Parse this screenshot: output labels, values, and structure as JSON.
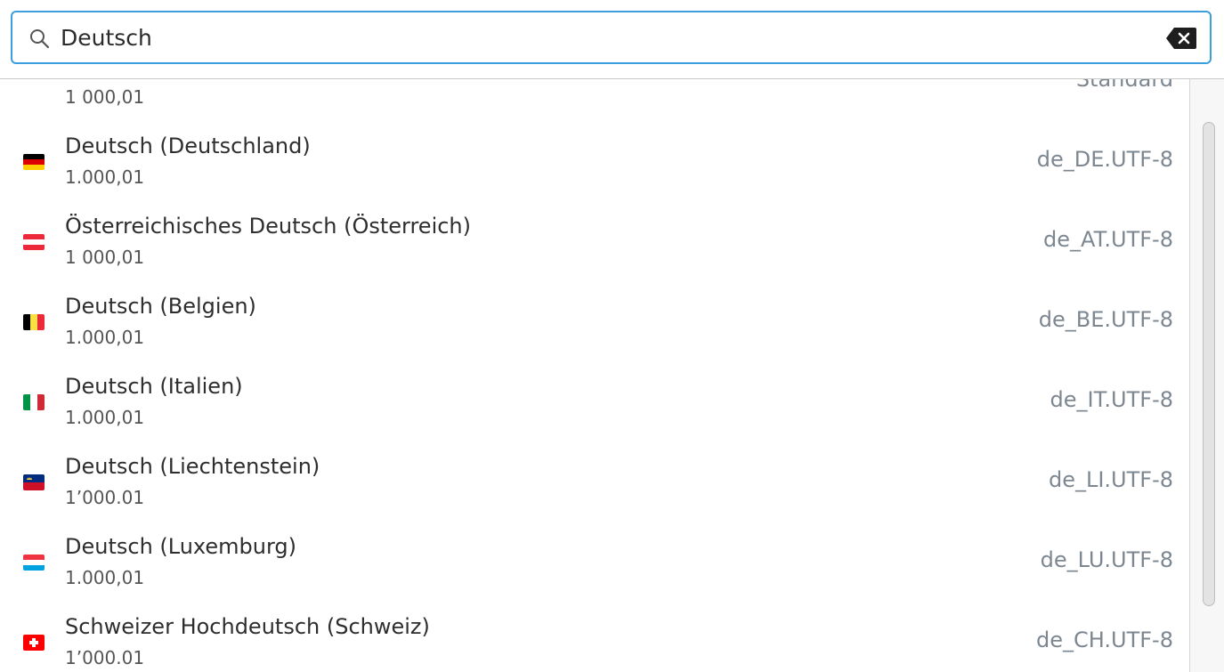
{
  "search": {
    "value": "Deutsch",
    "clear_icon": "backspace-clear-icon",
    "search_icon": "magnifier-search-icon"
  },
  "colors": {
    "focus_border": "#3d9ede",
    "primary_text": "#2e2e2e",
    "secondary_text": "#555555",
    "locale_text": "#7d8791"
  },
  "locales": [
    {
      "name": "",
      "number_format": "1 000,01",
      "code": "Standard",
      "flag": "none"
    },
    {
      "name": "Deutsch (Deutschland)",
      "number_format": "1.000,01",
      "code": "de_DE.UTF-8",
      "flag": "germany-flag-icon"
    },
    {
      "name": "Österreichisches Deutsch (Österreich)",
      "number_format": "1 000,01",
      "code": "de_AT.UTF-8",
      "flag": "austria-flag-icon"
    },
    {
      "name": "Deutsch (Belgien)",
      "number_format": "1.000,01",
      "code": "de_BE.UTF-8",
      "flag": "belgium-flag-icon"
    },
    {
      "name": "Deutsch (Italien)",
      "number_format": "1.000,01",
      "code": "de_IT.UTF-8",
      "flag": "italy-flag-icon"
    },
    {
      "name": "Deutsch (Liechtenstein)",
      "number_format": "1’000.01",
      "code": "de_LI.UTF-8",
      "flag": "liechtenstein-flag-icon"
    },
    {
      "name": "Deutsch (Luxemburg)",
      "number_format": "1.000,01",
      "code": "de_LU.UTF-8",
      "flag": "luxembourg-flag-icon"
    },
    {
      "name": "Schweizer Hochdeutsch (Schweiz)",
      "number_format": "1’000.01",
      "code": "de_CH.UTF-8",
      "flag": "switzerland-flag-icon"
    }
  ]
}
